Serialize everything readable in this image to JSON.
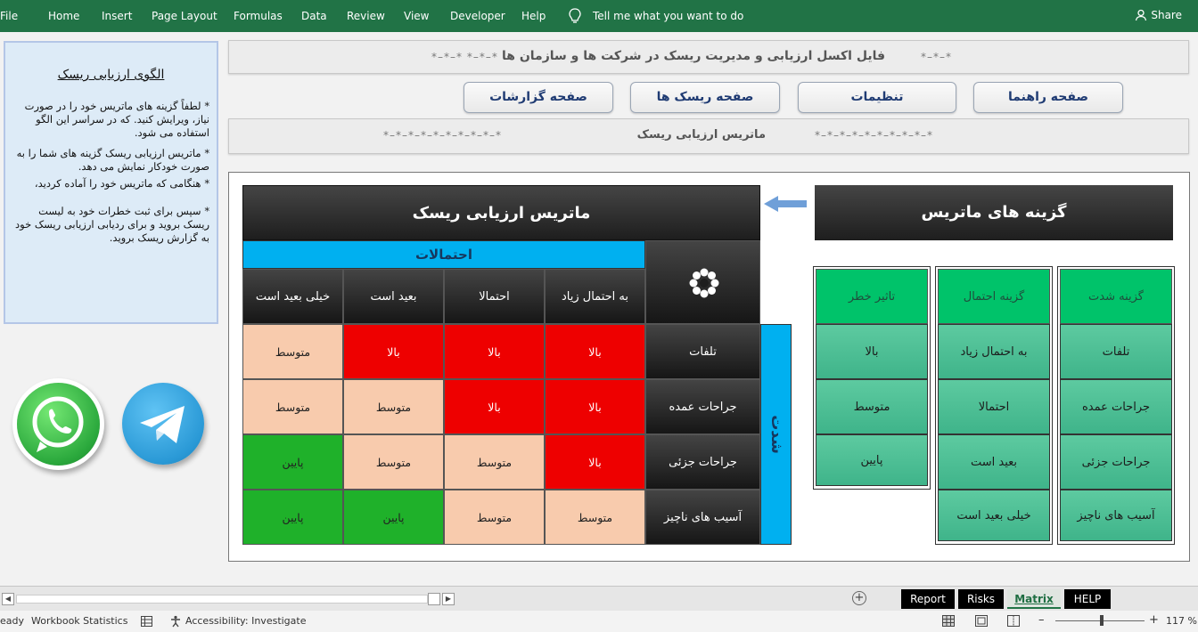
{
  "ribbon": {
    "tabs": [
      "File",
      "Home",
      "Insert",
      "Page Layout",
      "Formulas",
      "Data",
      "Review",
      "View",
      "Developer",
      "Help"
    ],
    "tell_me": "Tell me what you want to do",
    "share": "Share"
  },
  "info_panel": {
    "title": "الگوی ارزیابی ریسک",
    "lines": [
      {
        "bullet": "*",
        "text": "لطفاً گزینه های ماتریس خود را در صورت نیاز، ویرایش کنید. که در سراسر این الگو استفاده می شود."
      },
      {
        "bullet": "*",
        "text": "ماتریس ارزیابی ریسک گزینه های شما را به صورت خودکار نمایش می دهد."
      },
      {
        "bullet": "*",
        "text": "هنگامی که ماتریس خود را آماده کردید،"
      },
      {
        "bullet": "*",
        "text": "سپس برای ثبت خطرات خود به لیست ریسک بروید و برای ردیابی ارزیابی ریسک خود به گزارش ریسک بروید."
      }
    ]
  },
  "banner": {
    "title": "فایل اکسل ارزیابی و مدیریت ریسک در شرکت ها و سازمان ها",
    "deco_left": "*–*–*   *–*–*",
    "deco_right": "*–*–*",
    "sub_title": "ماتریس ارزیابی ریسک",
    "sub_deco_left": "*–*–*–*–*–*–*–*–*–*",
    "sub_deco_right": "*–*–*–*–*–*–*–*–*–*"
  },
  "nav": {
    "guide": "صفحه راهنما",
    "settings": "تنظیمات",
    "risks": "صفحه ریسک ها",
    "reports": "صفحه گزارشات"
  },
  "matrix": {
    "title": "ماتریس ارزیابی ریسک",
    "prob_label": "احتمالات",
    "severity_label": "شدت",
    "prob_headers": [
      "خیلی بعید است",
      "بعید است",
      "احتمالا",
      "به احتمال زیاد"
    ],
    "severity_rows": [
      "تلفات",
      "جراحات عمده",
      "جراحات جزئی",
      "آسیب های ناچیز"
    ],
    "cells": [
      [
        "متوسط",
        "بالا",
        "بالا",
        "بالا"
      ],
      [
        "متوسط",
        "متوسط",
        "بالا",
        "بالا"
      ],
      [
        "پایین",
        "متوسط",
        "متوسط",
        "بالا"
      ],
      [
        "پایین",
        "پایین",
        "متوسط",
        "متوسط"
      ]
    ],
    "level_colors": {
      "بالا": "#ee0000",
      "متوسط": "#f8cbad",
      "پایین": "#1fb12a"
    }
  },
  "options": {
    "title": "گزینه های ماتریس",
    "columns": [
      {
        "header": "گزینه شدت",
        "items": [
          "تلفات",
          "جراحات عمده",
          "جراحات جزئی",
          "آسیب های ناچیز"
        ]
      },
      {
        "header": "گزینه احتمال",
        "items": [
          "به احتمال زیاد",
          "احتمالا",
          "بعید است",
          "خیلی بعید است"
        ]
      },
      {
        "header": "تاثیر خطر",
        "items": [
          "بالا",
          "متوسط",
          "پایین"
        ]
      }
    ]
  },
  "sheet_tabs": [
    {
      "label": "Report",
      "active": false
    },
    {
      "label": "Risks",
      "active": false
    },
    {
      "label": "Matrix",
      "active": true
    },
    {
      "label": "HELP",
      "active": false
    }
  ],
  "status": {
    "ready": "eady",
    "workbook_stats": "Workbook Statistics",
    "accessibility": "Accessibility: Investigate",
    "zoom": "117 %",
    "minus": "–",
    "plus": "+"
  }
}
